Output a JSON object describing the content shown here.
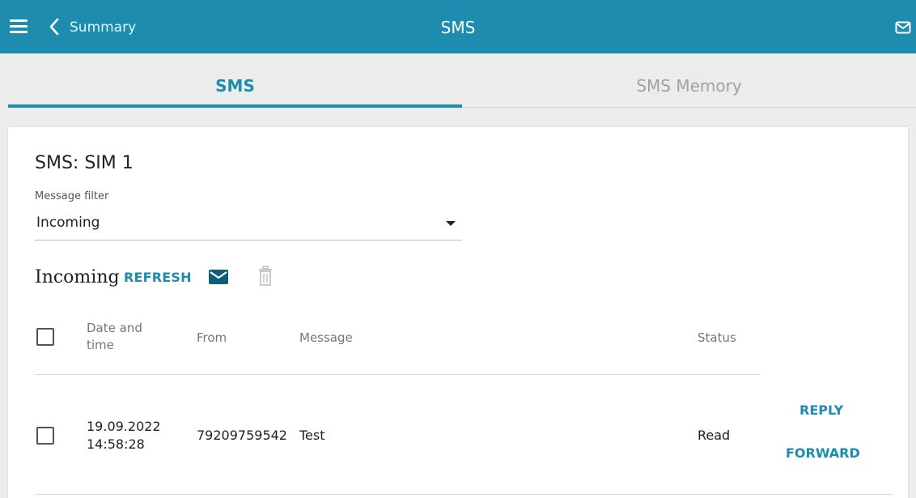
{
  "header": {
    "back_label": "Summary",
    "title": "SMS"
  },
  "tabs": [
    {
      "label": "SMS",
      "active": true
    },
    {
      "label": "SMS Memory",
      "active": false
    }
  ],
  "card": {
    "title": "SMS: SIM 1",
    "filter": {
      "label": "Message filter",
      "value": "Incoming"
    },
    "section": {
      "title": "Incoming",
      "refresh_label": "REFRESH"
    },
    "table": {
      "headers": {
        "date_line1": "Date and",
        "date_line2": "time",
        "from": "From",
        "message": "Message",
        "status": "Status"
      },
      "rows": [
        {
          "date": "19.09.2022",
          "time": "14:58:28",
          "from": "79209759542",
          "message": "Test",
          "status": "Read",
          "reply_label": "REPLY",
          "forward_label": "FORWARD"
        }
      ]
    }
  },
  "colors": {
    "accent": "#1e8caf",
    "background": "#ececec"
  },
  "icons": [
    "menu-icon",
    "chevron-left-icon",
    "mail-icon",
    "write-message-icon",
    "trash-icon",
    "caret-down-icon"
  ]
}
